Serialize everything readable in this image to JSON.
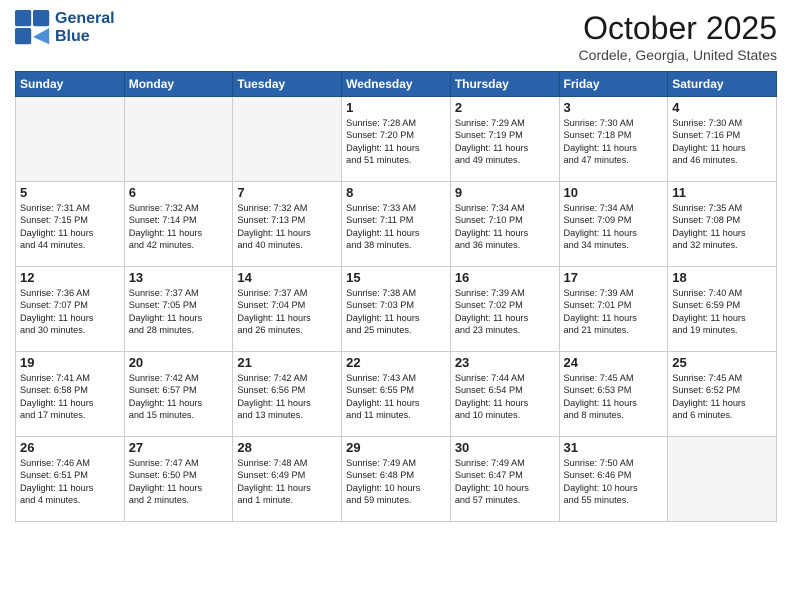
{
  "header": {
    "logo_line1": "General",
    "logo_line2": "Blue",
    "month": "October 2025",
    "location": "Cordele, Georgia, United States"
  },
  "weekdays": [
    "Sunday",
    "Monday",
    "Tuesday",
    "Wednesday",
    "Thursday",
    "Friday",
    "Saturday"
  ],
  "weeks": [
    [
      {
        "day": "",
        "info": "",
        "empty": true
      },
      {
        "day": "",
        "info": "",
        "empty": true
      },
      {
        "day": "",
        "info": "",
        "empty": true
      },
      {
        "day": "1",
        "info": "Sunrise: 7:28 AM\nSunset: 7:20 PM\nDaylight: 11 hours\nand 51 minutes."
      },
      {
        "day": "2",
        "info": "Sunrise: 7:29 AM\nSunset: 7:19 PM\nDaylight: 11 hours\nand 49 minutes."
      },
      {
        "day": "3",
        "info": "Sunrise: 7:30 AM\nSunset: 7:18 PM\nDaylight: 11 hours\nand 47 minutes."
      },
      {
        "day": "4",
        "info": "Sunrise: 7:30 AM\nSunset: 7:16 PM\nDaylight: 11 hours\nand 46 minutes."
      }
    ],
    [
      {
        "day": "5",
        "info": "Sunrise: 7:31 AM\nSunset: 7:15 PM\nDaylight: 11 hours\nand 44 minutes."
      },
      {
        "day": "6",
        "info": "Sunrise: 7:32 AM\nSunset: 7:14 PM\nDaylight: 11 hours\nand 42 minutes."
      },
      {
        "day": "7",
        "info": "Sunrise: 7:32 AM\nSunset: 7:13 PM\nDaylight: 11 hours\nand 40 minutes."
      },
      {
        "day": "8",
        "info": "Sunrise: 7:33 AM\nSunset: 7:11 PM\nDaylight: 11 hours\nand 38 minutes."
      },
      {
        "day": "9",
        "info": "Sunrise: 7:34 AM\nSunset: 7:10 PM\nDaylight: 11 hours\nand 36 minutes."
      },
      {
        "day": "10",
        "info": "Sunrise: 7:34 AM\nSunset: 7:09 PM\nDaylight: 11 hours\nand 34 minutes."
      },
      {
        "day": "11",
        "info": "Sunrise: 7:35 AM\nSunset: 7:08 PM\nDaylight: 11 hours\nand 32 minutes."
      }
    ],
    [
      {
        "day": "12",
        "info": "Sunrise: 7:36 AM\nSunset: 7:07 PM\nDaylight: 11 hours\nand 30 minutes."
      },
      {
        "day": "13",
        "info": "Sunrise: 7:37 AM\nSunset: 7:05 PM\nDaylight: 11 hours\nand 28 minutes."
      },
      {
        "day": "14",
        "info": "Sunrise: 7:37 AM\nSunset: 7:04 PM\nDaylight: 11 hours\nand 26 minutes."
      },
      {
        "day": "15",
        "info": "Sunrise: 7:38 AM\nSunset: 7:03 PM\nDaylight: 11 hours\nand 25 minutes."
      },
      {
        "day": "16",
        "info": "Sunrise: 7:39 AM\nSunset: 7:02 PM\nDaylight: 11 hours\nand 23 minutes."
      },
      {
        "day": "17",
        "info": "Sunrise: 7:39 AM\nSunset: 7:01 PM\nDaylight: 11 hours\nand 21 minutes."
      },
      {
        "day": "18",
        "info": "Sunrise: 7:40 AM\nSunset: 6:59 PM\nDaylight: 11 hours\nand 19 minutes."
      }
    ],
    [
      {
        "day": "19",
        "info": "Sunrise: 7:41 AM\nSunset: 6:58 PM\nDaylight: 11 hours\nand 17 minutes."
      },
      {
        "day": "20",
        "info": "Sunrise: 7:42 AM\nSunset: 6:57 PM\nDaylight: 11 hours\nand 15 minutes."
      },
      {
        "day": "21",
        "info": "Sunrise: 7:42 AM\nSunset: 6:56 PM\nDaylight: 11 hours\nand 13 minutes."
      },
      {
        "day": "22",
        "info": "Sunrise: 7:43 AM\nSunset: 6:55 PM\nDaylight: 11 hours\nand 11 minutes."
      },
      {
        "day": "23",
        "info": "Sunrise: 7:44 AM\nSunset: 6:54 PM\nDaylight: 11 hours\nand 10 minutes."
      },
      {
        "day": "24",
        "info": "Sunrise: 7:45 AM\nSunset: 6:53 PM\nDaylight: 11 hours\nand 8 minutes."
      },
      {
        "day": "25",
        "info": "Sunrise: 7:45 AM\nSunset: 6:52 PM\nDaylight: 11 hours\nand 6 minutes."
      }
    ],
    [
      {
        "day": "26",
        "info": "Sunrise: 7:46 AM\nSunset: 6:51 PM\nDaylight: 11 hours\nand 4 minutes."
      },
      {
        "day": "27",
        "info": "Sunrise: 7:47 AM\nSunset: 6:50 PM\nDaylight: 11 hours\nand 2 minutes."
      },
      {
        "day": "28",
        "info": "Sunrise: 7:48 AM\nSunset: 6:49 PM\nDaylight: 11 hours\nand 1 minute."
      },
      {
        "day": "29",
        "info": "Sunrise: 7:49 AM\nSunset: 6:48 PM\nDaylight: 10 hours\nand 59 minutes."
      },
      {
        "day": "30",
        "info": "Sunrise: 7:49 AM\nSunset: 6:47 PM\nDaylight: 10 hours\nand 57 minutes."
      },
      {
        "day": "31",
        "info": "Sunrise: 7:50 AM\nSunset: 6:46 PM\nDaylight: 10 hours\nand 55 minutes."
      },
      {
        "day": "",
        "info": "",
        "empty": true
      }
    ]
  ]
}
